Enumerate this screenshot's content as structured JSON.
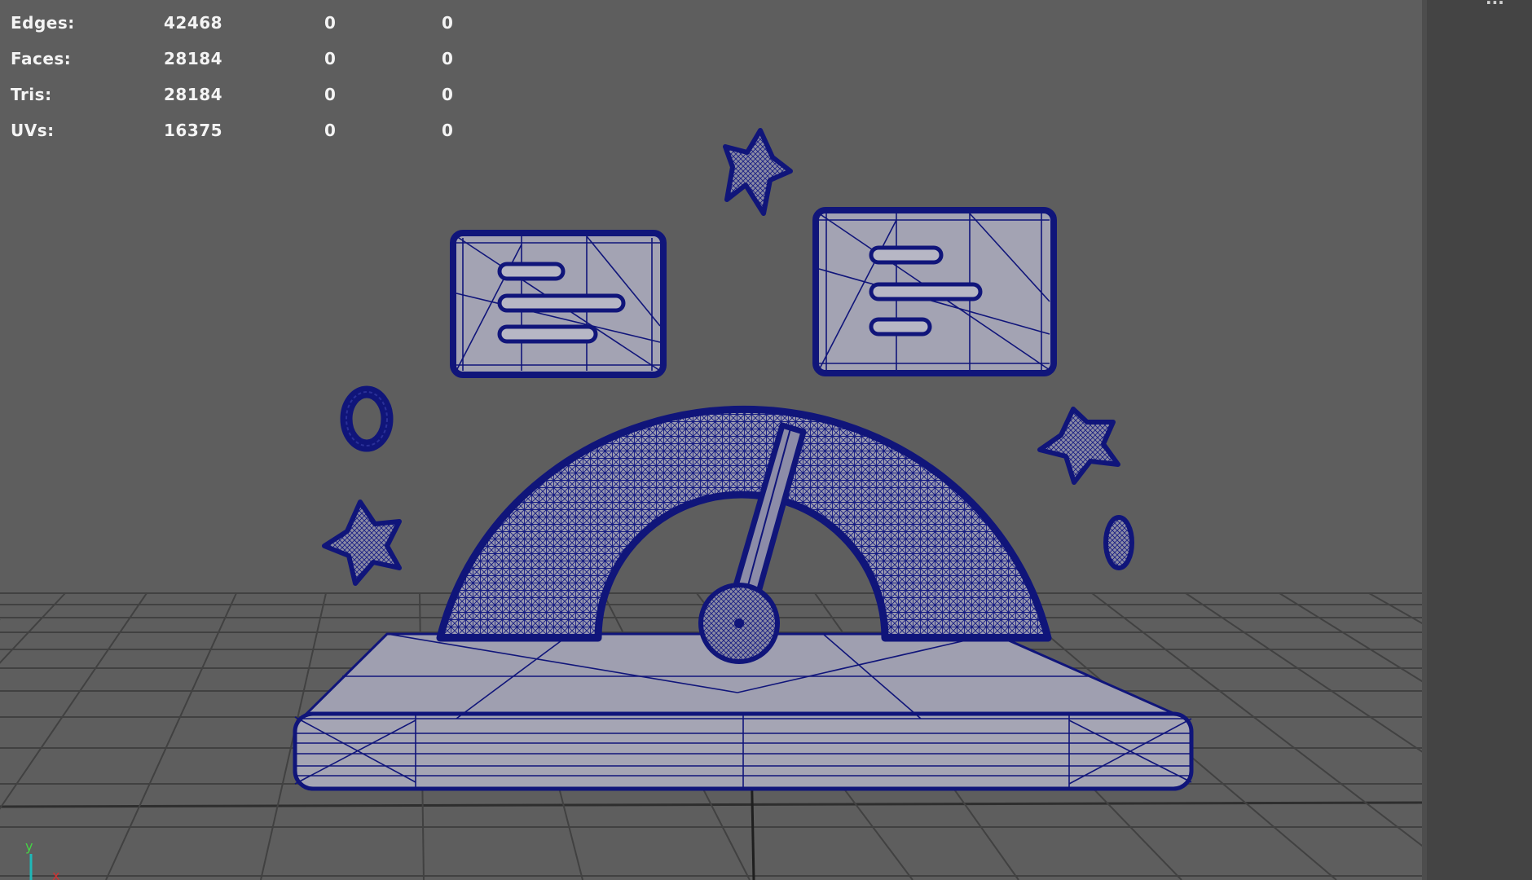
{
  "hud": {
    "rows": [
      {
        "label": "Edges:",
        "value": "42468",
        "selected": "0",
        "component": "0"
      },
      {
        "label": "Faces:",
        "value": "28184",
        "selected": "0",
        "component": "0"
      },
      {
        "label": "Tris:",
        "value": "28184",
        "selected": "0",
        "component": "0"
      },
      {
        "label": "UVs:",
        "value": "16375",
        "selected": "0",
        "component": "0"
      }
    ]
  },
  "axis": {
    "y_label": "y",
    "x_label": "x"
  },
  "right_panel": {
    "text": "..."
  },
  "colors": {
    "viewport_bg": "#5e5e5e",
    "grid_line": "#3f3f3f",
    "wire": "#10157a",
    "mesh_fill": "#9c9caa",
    "panel_bg": "#444444"
  }
}
